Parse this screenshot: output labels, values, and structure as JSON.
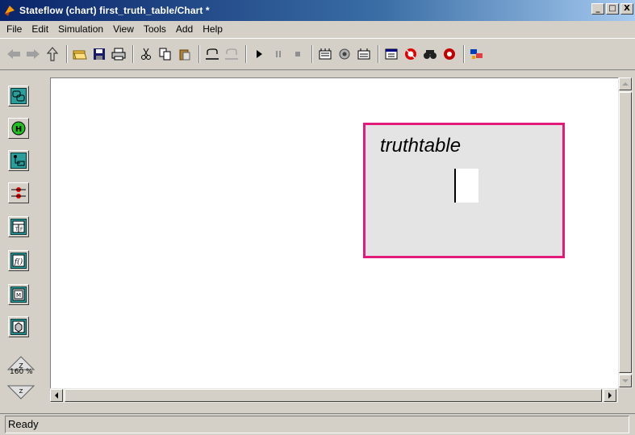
{
  "window": {
    "title": "Stateflow (chart) first_truth_table/Chart *",
    "minimize_label": "_",
    "maximize_label": "□",
    "close_label": "X"
  },
  "menu": {
    "items": [
      "File",
      "Edit",
      "Simulation",
      "View",
      "Tools",
      "Add",
      "Help"
    ]
  },
  "toolbar": {
    "icons": [
      "back-arrow-icon",
      "forward-arrow-icon",
      "up-arrow-icon",
      "open-folder-icon",
      "save-icon",
      "print-icon",
      "cut-icon",
      "copy-icon",
      "paste-icon",
      "undo-icon",
      "redo-icon",
      "play-icon",
      "pause-icon",
      "stop-icon",
      "build-icon",
      "debug-icon",
      "target-icon",
      "explorer-icon",
      "debugger-icon",
      "find-icon",
      "stop-sign-icon",
      "simulink-icon"
    ]
  },
  "palette": {
    "tools": [
      "state-tool-icon",
      "history-junction-icon",
      "default-transition-icon",
      "connective-junction-icon",
      "truth-table-tool-icon",
      "function-tool-icon",
      "embedded-matlab-icon",
      "box-tool-icon"
    ],
    "zoom_label": "160 %",
    "zoom_z": "Z"
  },
  "canvas": {
    "truthtable_label": "truthtable"
  },
  "status": {
    "text": "Ready"
  },
  "colors": {
    "titlebar_start": "#0a246a",
    "truthtable_border": "#e31b7a",
    "palette_icon": "#2a9d9d"
  }
}
